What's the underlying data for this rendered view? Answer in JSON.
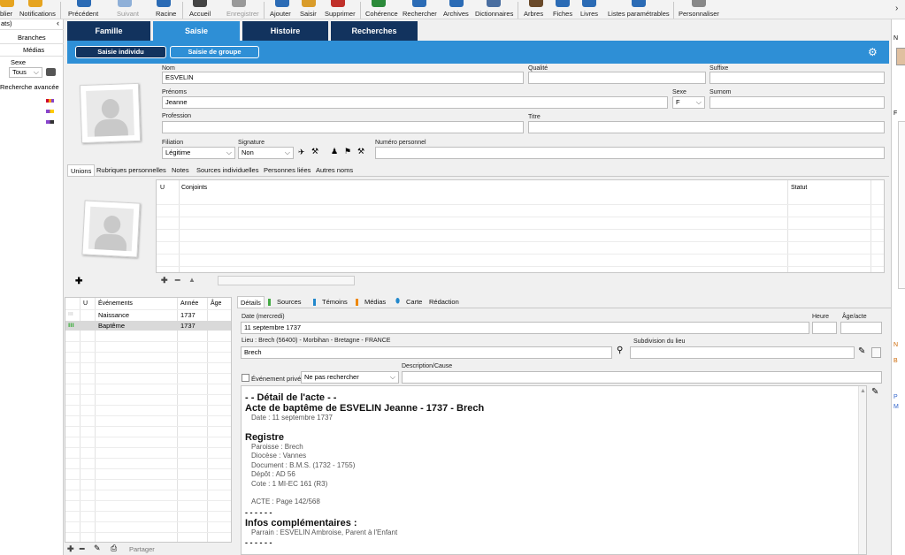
{
  "toolbar": {
    "items": [
      "blier",
      "Notifications",
      "Précédent",
      "Suivant",
      "Racine",
      "Accueil",
      "Enregistrer",
      "Ajouter",
      "Saisir",
      "Supprimer",
      "Cohérence",
      "Rechercher",
      "Archives",
      "Dictionnaires",
      "Arbres",
      "Fiches",
      "Livres",
      "Listes paramétrables",
      "Personnaliser"
    ]
  },
  "left_panel": {
    "header": "ats)",
    "branches": "Branches",
    "medias": "Médias",
    "sexe_label": "Sexe",
    "sexe_value": "Tous",
    "recherche_avancee": "Recherche avancée"
  },
  "main_tabs": [
    "Famille",
    "Saisie",
    "Histoire",
    "Recherches"
  ],
  "sub_tabs": [
    "Saisie individu",
    "Saisie de groupe"
  ],
  "form": {
    "nom_label": "Nom",
    "nom_value": "ESVELIN",
    "qualite_label": "Qualité",
    "suffixe_label": "Suffixe",
    "prenoms_label": "Prénoms",
    "prenoms_value": "Jeanne",
    "sexe_label": "Sexe",
    "sexe_value": "F",
    "surnom_label": "Surnom",
    "profession_label": "Profession",
    "titre_label": "Titre",
    "filiation_label": "Filiation",
    "filiation_value": "Légitime",
    "signature_label": "Signature",
    "signature_value": "Non",
    "numero_label": "Numéro personnel"
  },
  "section_tabs": [
    "Unions",
    "Rubriques personnelles",
    "Notes",
    "Sources individuelles",
    "Personnes liées",
    "Autres noms"
  ],
  "unions_table": {
    "col_u": "U",
    "col_conjoints": "Conjoints",
    "col_statut": "Statut"
  },
  "events": {
    "col_u": "U",
    "col_evenements": "Événements",
    "col_annee": "Année",
    "col_age": "Âge",
    "rows": [
      {
        "name": "Naissance",
        "year": "1737"
      },
      {
        "name": "Baptême",
        "year": "1737"
      }
    ],
    "footer_partager": "Partager"
  },
  "detail_tabs": [
    "Détails",
    "Sources",
    "Témoins",
    "Médias",
    "Carte",
    "Rédaction"
  ],
  "event_detail": {
    "date_label": "Date (mercredi)",
    "date_value": "11 septembre 1737",
    "heure_label": "Heure",
    "age_label": "Âge/acte",
    "lieu_label": "Lieu : Brech (56400) - Morbihan - Bretagne - FRANCE",
    "lieu_value": "Brech",
    "subdivision_label": "Subdivision du lieu",
    "description_label": "Description/Cause",
    "prive_label": "Événement privé",
    "recherche_value": "Ne pas rechercher"
  },
  "acte": {
    "heading": "- - Détail de l'acte - -",
    "title": "Acte de baptême de ESVELIN Jeanne - 1737 - Brech",
    "date_line": "Date : 11 septembre 1737",
    "registre_heading": "Registre",
    "registre_lines": [
      "Paroisse : Brech",
      "Diocèse : Vannes",
      "Document : B.M.S. (1732 - 1755)",
      "Dépôt : AD 56",
      "Cote : 1 MI-EC 161 (R3)"
    ],
    "acte_line": "ACTE : Page 142/568",
    "dashes": "- - - - - -",
    "infos_heading": "Infos complémentaires :",
    "parrain_line": "Parrain : ESVELIN Ambroise, Parent à l'Enfant",
    "dashes2": "- - - - - -"
  },
  "right_panel": {
    "letters": [
      "N",
      "F",
      "N",
      "B",
      "P",
      "M"
    ]
  }
}
